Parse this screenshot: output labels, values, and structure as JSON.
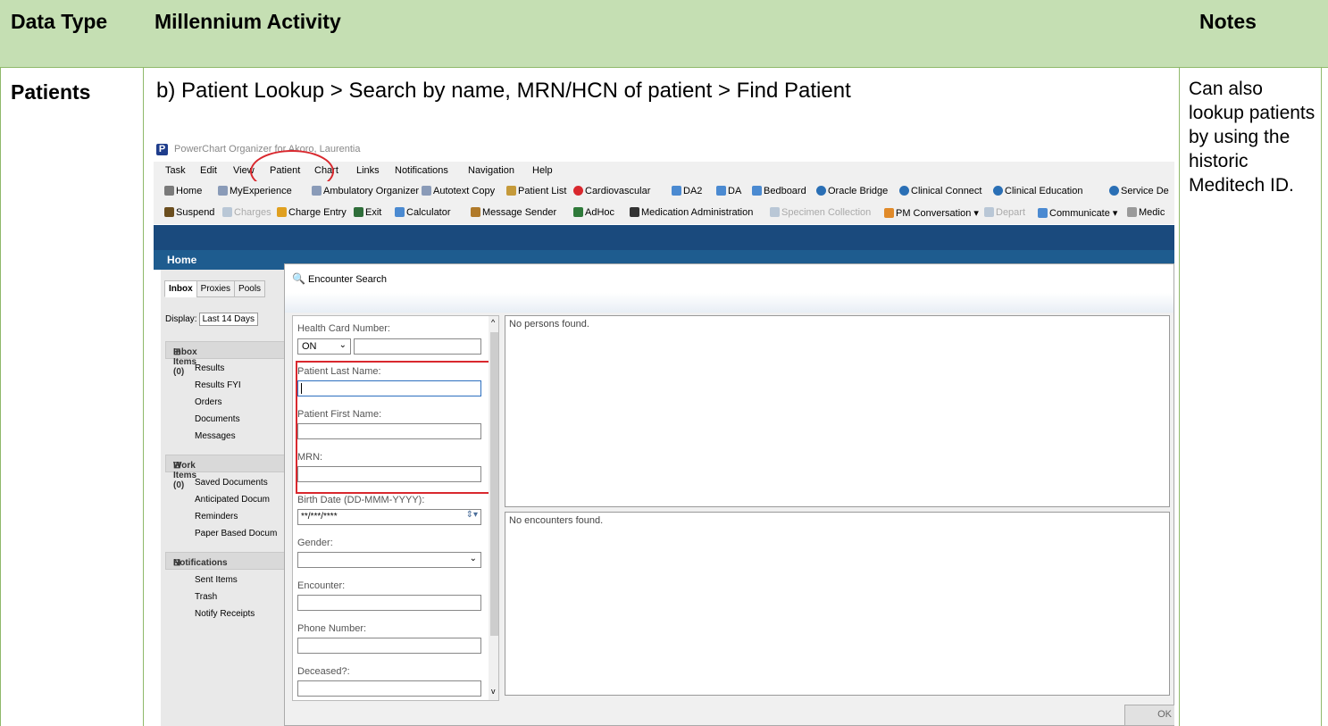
{
  "table": {
    "header": {
      "col1": "Data Type",
      "col2": "Millennium Activity",
      "col3": "Notes"
    },
    "row": {
      "data_type": "Patients",
      "activity": "b)   Patient Lookup > Search by name, MRN/HCN of patient > Find Patient",
      "notes": "Can also lookup patients by using the historic Meditech ID."
    }
  },
  "screenshot": {
    "app_title": "PowerChart Organizer for Akoro, Laurentia",
    "logo_letter": "P",
    "menu": [
      "Task",
      "Edit",
      "View",
      "Patient",
      "Chart",
      "Links",
      "Notifications",
      "Navigation",
      "Help"
    ],
    "toolbar1": [
      "Home",
      "MyExperience",
      "Ambulatory Organizer",
      "Autotext Copy",
      "Patient List",
      "Cardiovascular",
      "DA2",
      "DA",
      "Bedboard",
      "Oracle Bridge",
      "Clinical Connect",
      "Clinical Education",
      "Service De"
    ],
    "toolbar2": [
      "Suspend",
      "Charges",
      "Charge Entry",
      "Exit",
      "Calculator",
      "Message Sender",
      "AdHoc",
      "Medication Administration",
      "Specimen Collection",
      "PM Conversation ▾",
      "Depart",
      "Communicate ▾",
      "Medic"
    ],
    "home_label": "Home",
    "tabs": [
      "Inbox",
      "Proxies",
      "Pools"
    ],
    "display_label": "Display:",
    "display_value": "Last 14 Days",
    "groups": {
      "inbox": {
        "title": "Inbox Items (0)",
        "items": [
          "Results",
          "Results FYI",
          "Orders",
          "Documents",
          "Messages"
        ]
      },
      "work": {
        "title": "Work Items (0)",
        "items": [
          "Saved Documents",
          "Anticipated Docum",
          "Reminders",
          "Paper Based Docum"
        ]
      },
      "notif": {
        "title": "Notifications",
        "items": [
          "Sent Items",
          "Trash",
          "Notify Receipts"
        ]
      }
    },
    "dialog": {
      "title": "Encounter Search",
      "hcn_label": "Health Card Number:",
      "hcn_province": "ON",
      "last_name_label": "Patient Last Name:",
      "first_name_label": "Patient First Name:",
      "mrn_label": "MRN:",
      "birth_label": "Birth Date (DD-MMM-YYYY):",
      "birth_value": "**/***/****",
      "gender_label": "Gender:",
      "encounter_label": "Encounter:",
      "phone_label": "Phone Number:",
      "deceased_label": "Deceased?:",
      "persons_result": "No persons found.",
      "encounters_result": "No encounters found.",
      "ok_label": "OK"
    }
  }
}
